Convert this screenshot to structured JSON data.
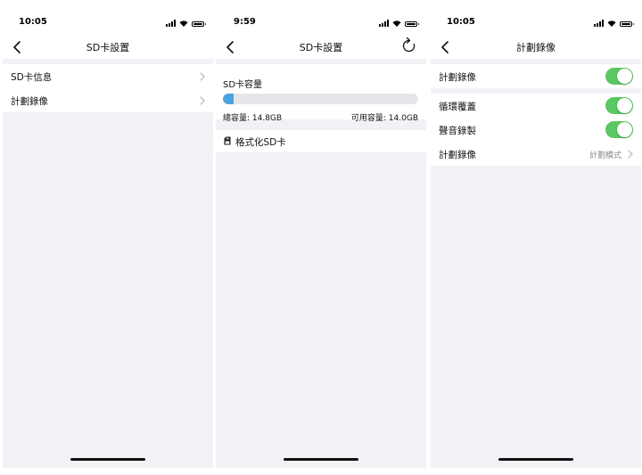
{
  "screens": [
    {
      "time": "10:05",
      "title": "SD卡設置",
      "rows": [
        {
          "label": "SD卡信息"
        },
        {
          "label": "計劃錄像"
        }
      ]
    },
    {
      "time": "9:59",
      "title": "SD卡設置",
      "capacity": {
        "title": "SD卡容量",
        "total": "總容量: 14.8GB",
        "free": "可用容量: 14.0GB",
        "used_fraction": 0.054
      },
      "format_label": "格式化SD卡"
    },
    {
      "time": "10:05",
      "title": "計劃錄像",
      "toggle_rows": [
        {
          "label": "計劃錄像",
          "on": true
        },
        {
          "label": "循環覆蓋",
          "on": true
        },
        {
          "label": "聲音錄製",
          "on": true
        }
      ],
      "schedule_row": {
        "label": "計劃錄像",
        "value": "計劃模式"
      }
    }
  ],
  "colors": {
    "accent_toggle": "#5ac762",
    "capacity_bar": "#4aa3df",
    "background": "#f1f1f6"
  },
  "icons": [
    "signal-icon",
    "wifi-icon",
    "battery-icon",
    "back-chevron-icon",
    "chevron-right-icon",
    "refresh-icon",
    "format-icon"
  ]
}
